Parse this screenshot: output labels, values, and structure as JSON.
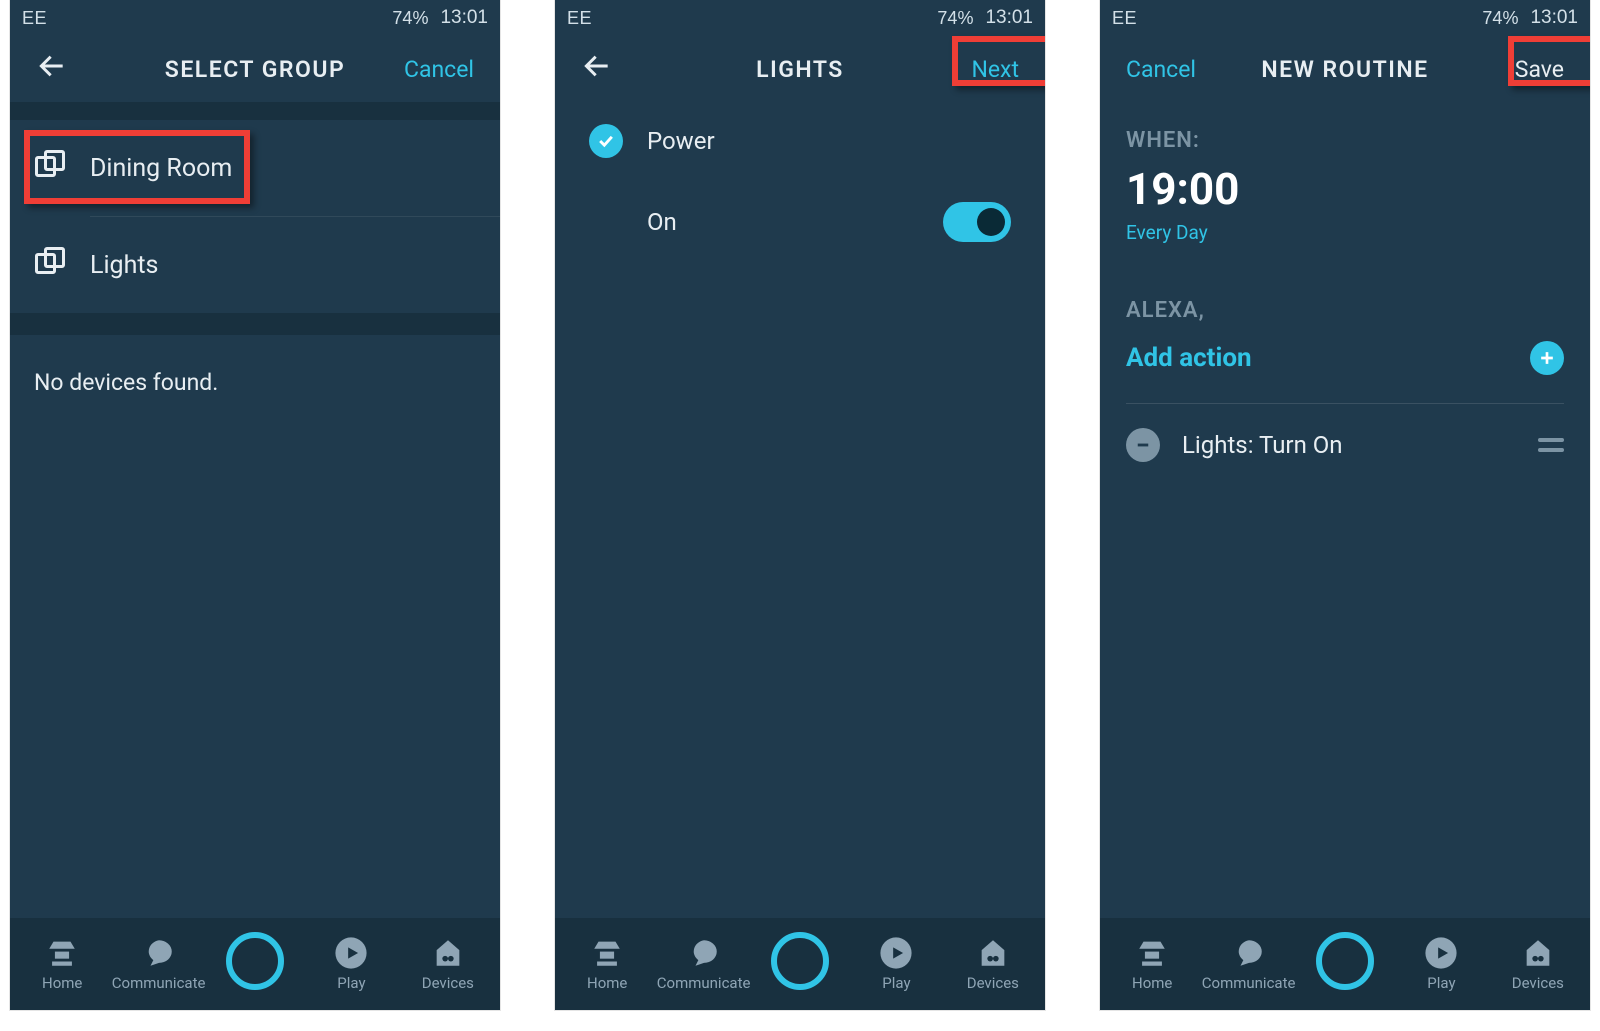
{
  "status": {
    "carrier": "EE",
    "battery_pct": "74%",
    "time": "13:01"
  },
  "nav": {
    "home": "Home",
    "communicate": "Communicate",
    "play": "Play",
    "devices": "Devices"
  },
  "screens": [
    {
      "title": "SELECT GROUP",
      "right_btn": "Cancel",
      "groups": [
        "Dining Room",
        "Lights"
      ],
      "empty_msg": "No devices found."
    },
    {
      "title": "LIGHTS",
      "right_btn": "Next",
      "opt_power": "Power",
      "opt_on": "On"
    },
    {
      "title": "NEW ROUTINE",
      "left_btn": "Cancel",
      "right_btn": "Save",
      "when_label": "WHEN:",
      "time": "19:00",
      "time_sub": "Every Day",
      "alexa_label": "ALEXA,",
      "add_action": "Add action",
      "routine_item": "Lights: Turn On"
    }
  ]
}
